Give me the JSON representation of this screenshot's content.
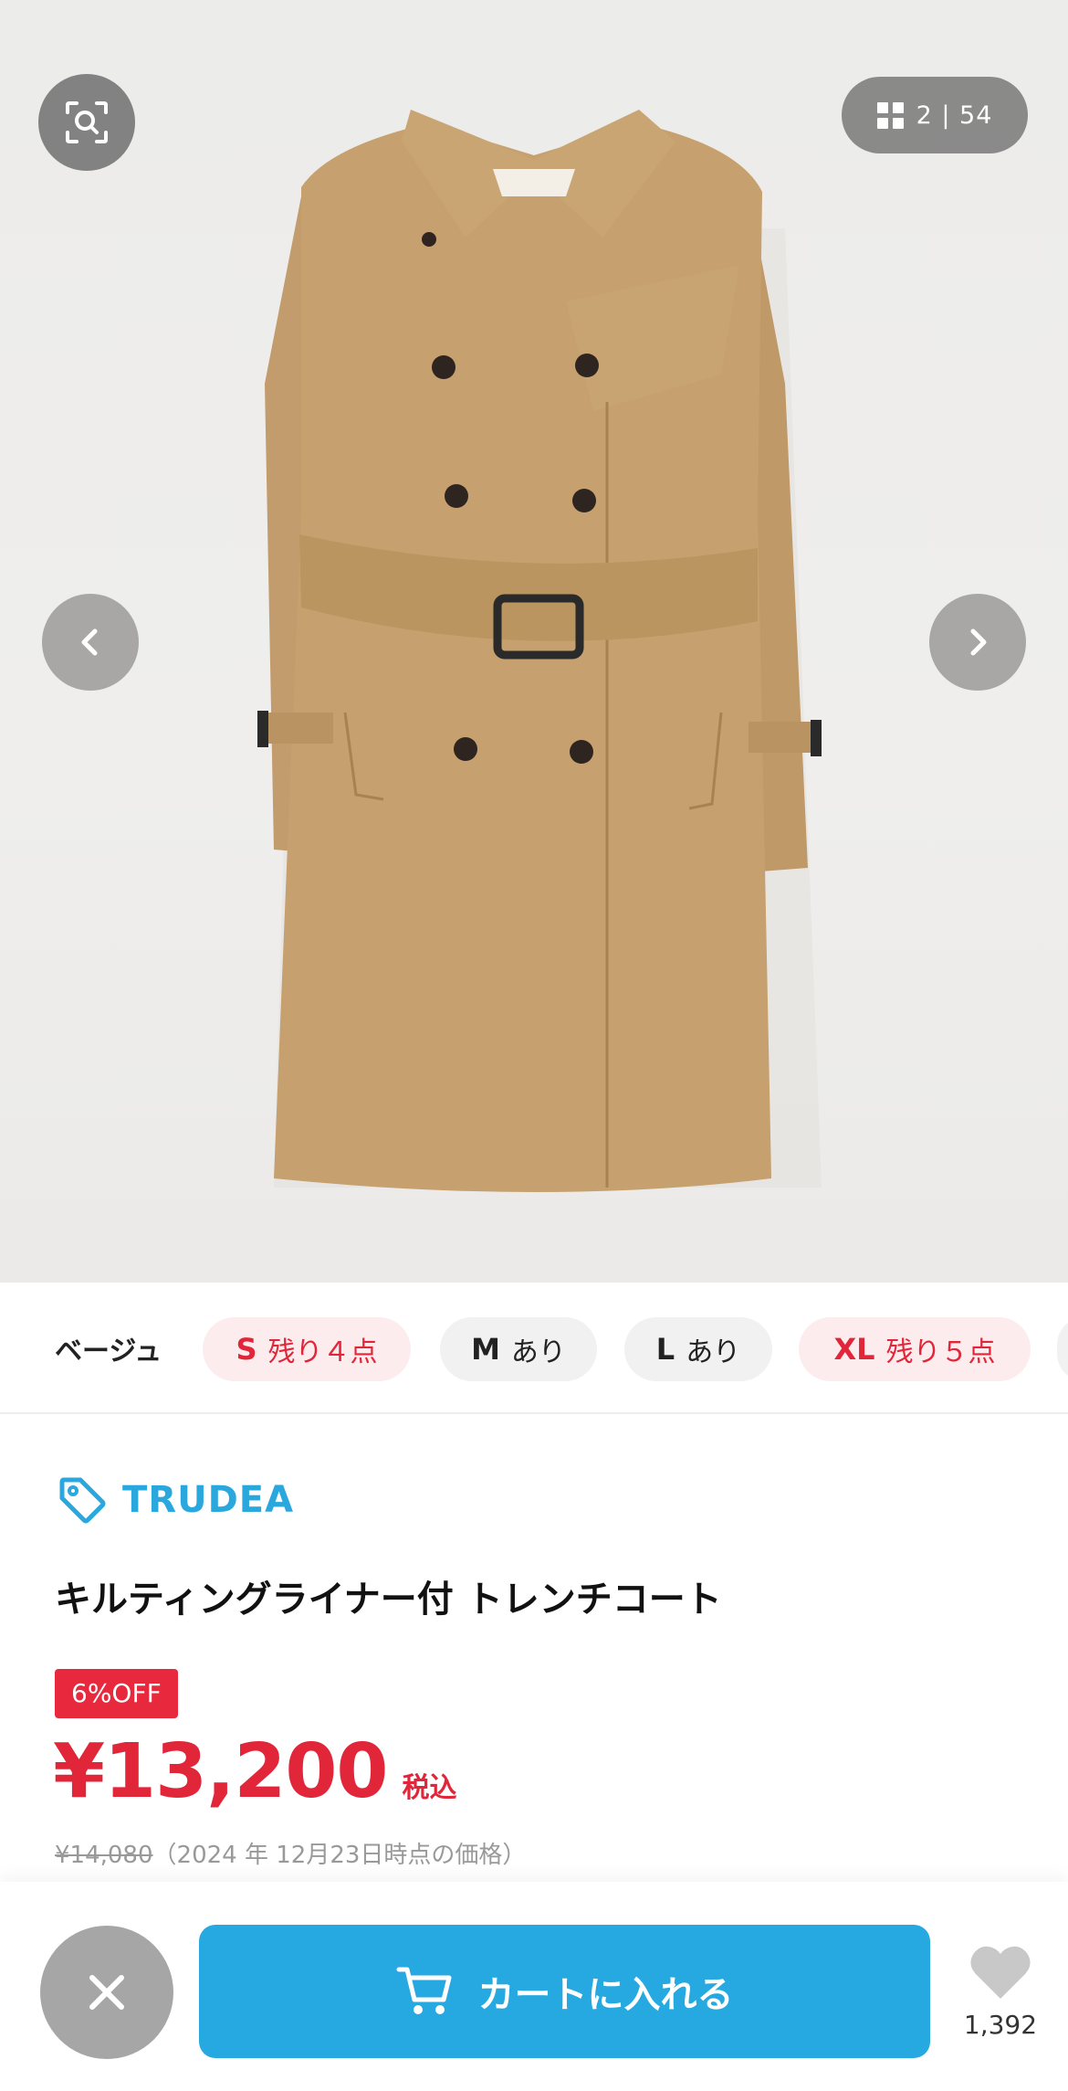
{
  "gallery": {
    "counter": "2 | 54",
    "zoom_icon": "image-search-icon",
    "prev_icon": "chevron-left-icon",
    "next_icon": "chevron-right-icon",
    "photo_subject": "beige trench coat"
  },
  "variants": {
    "color_label": "ベージュ",
    "sizes": [
      {
        "size": "S",
        "stock": "残り４点",
        "status": "low"
      },
      {
        "size": "M",
        "stock": "あり",
        "status": "ok"
      },
      {
        "size": "L",
        "stock": "あり",
        "status": "ok"
      },
      {
        "size": "XL",
        "stock": "残り５点",
        "status": "low"
      }
    ]
  },
  "product": {
    "brand": "TRUDEA",
    "title": "キルティングライナー付 トレンチコート",
    "discount_badge": "6%OFF",
    "price": "¥13,200",
    "tax_label": "税込",
    "original_price": "¥14,080",
    "original_note": "（2024 年 12月23日時点の価格）"
  },
  "actions": {
    "cart_label": "カートに入れる",
    "favorite_count": "1,392"
  },
  "colors": {
    "accent": "#26a9e0",
    "sale": "#e2263a",
    "brand": "#2aa8dd"
  }
}
